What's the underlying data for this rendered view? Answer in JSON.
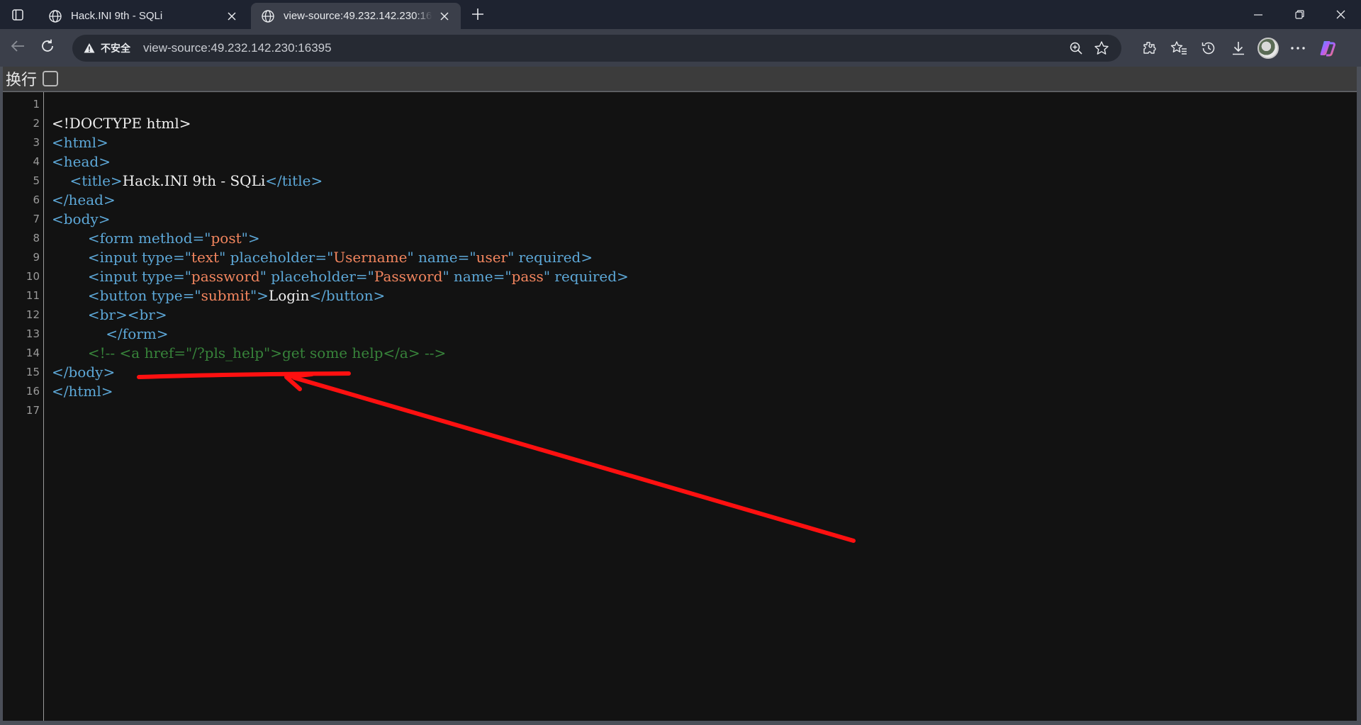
{
  "tabs": [
    {
      "title": "Hack.INI 9th - SQLi",
      "active": false
    },
    {
      "title": "view-source:49.232.142.230:16395",
      "active": true
    }
  ],
  "toolbar": {
    "security_label": "不安全",
    "url": "view-source:49.232.142.230:16395"
  },
  "viewer": {
    "wrap_label": "换行",
    "wrap_checked": false
  },
  "icons": {
    "tab_actions": "tab-actions-icon",
    "favicon": "globe-icon",
    "close": "close-icon",
    "new_tab": "plus-icon",
    "back": "back-arrow-icon",
    "reload": "reload-icon",
    "security": "warning-triangle-icon",
    "zoom": "zoom-icon",
    "favorite": "star-icon",
    "extensions": "extensions-icon",
    "favorites": "favorites-icon",
    "history": "history-icon",
    "downloads": "download-icon",
    "profile": "avatar",
    "more": "more-dots-icon",
    "copilot": "copilot-icon"
  },
  "colors": {
    "tag": "#5da8d8",
    "attribute_value": "#f2855e",
    "comment": "#37833a",
    "text": "#f0f0f0",
    "background": "#121212",
    "annotation_arrow": "#ff1010"
  },
  "source_lines": [
    {
      "n": "1",
      "parts": []
    },
    {
      "n": "2",
      "parts": [
        [
          "txt",
          "<!DOCTYPE html>"
        ]
      ]
    },
    {
      "n": "3",
      "parts": [
        [
          "tag",
          "<html>"
        ]
      ]
    },
    {
      "n": "4",
      "parts": [
        [
          "tag",
          "<head>"
        ]
      ]
    },
    {
      "n": "5",
      "parts": [
        [
          "txt",
          "    "
        ],
        [
          "tag",
          "<title>"
        ],
        [
          "txt",
          "Hack.INI 9th - SQLi"
        ],
        [
          "tag",
          "</title>"
        ]
      ]
    },
    {
      "n": "6",
      "parts": [
        [
          "tag",
          "</head>"
        ]
      ]
    },
    {
      "n": "7",
      "parts": [
        [
          "tag",
          "<body>"
        ]
      ]
    },
    {
      "n": "8",
      "parts": [
        [
          "txt",
          "        "
        ],
        [
          "tag",
          "<form method=\""
        ],
        [
          "val",
          "post"
        ],
        [
          "tag",
          "\">"
        ]
      ]
    },
    {
      "n": "9",
      "parts": [
        [
          "txt",
          "        "
        ],
        [
          "tag",
          "<input type=\""
        ],
        [
          "val",
          "text"
        ],
        [
          "tag",
          "\" placeholder=\""
        ],
        [
          "val",
          "Username"
        ],
        [
          "tag",
          "\" name=\""
        ],
        [
          "val",
          "user"
        ],
        [
          "tag",
          "\" required>"
        ]
      ]
    },
    {
      "n": "10",
      "parts": [
        [
          "txt",
          "        "
        ],
        [
          "tag",
          "<input type=\""
        ],
        [
          "val",
          "password"
        ],
        [
          "tag",
          "\" placeholder=\""
        ],
        [
          "val",
          "Password"
        ],
        [
          "tag",
          "\" name=\""
        ],
        [
          "val",
          "pass"
        ],
        [
          "tag",
          "\" required>"
        ]
      ]
    },
    {
      "n": "11",
      "parts": [
        [
          "txt",
          "        "
        ],
        [
          "tag",
          "<button type=\""
        ],
        [
          "val",
          "submit"
        ],
        [
          "tag",
          "\">"
        ],
        [
          "txt",
          "Login"
        ],
        [
          "tag",
          "</button>"
        ]
      ]
    },
    {
      "n": "12",
      "parts": [
        [
          "txt",
          "        "
        ],
        [
          "tag",
          "<br><br>"
        ]
      ]
    },
    {
      "n": "13",
      "parts": [
        [
          "txt",
          "            "
        ],
        [
          "tag",
          "</form>"
        ]
      ]
    },
    {
      "n": "14",
      "parts": [
        [
          "txt",
          "        "
        ],
        [
          "cmt",
          "<!-- <a href=\"/?pls_help\">get some help</a> -->"
        ]
      ]
    },
    {
      "n": "15",
      "parts": [
        [
          "tag",
          "</body>"
        ]
      ]
    },
    {
      "n": "16",
      "parts": [
        [
          "tag",
          "</html>"
        ]
      ]
    },
    {
      "n": "17",
      "parts": []
    }
  ]
}
